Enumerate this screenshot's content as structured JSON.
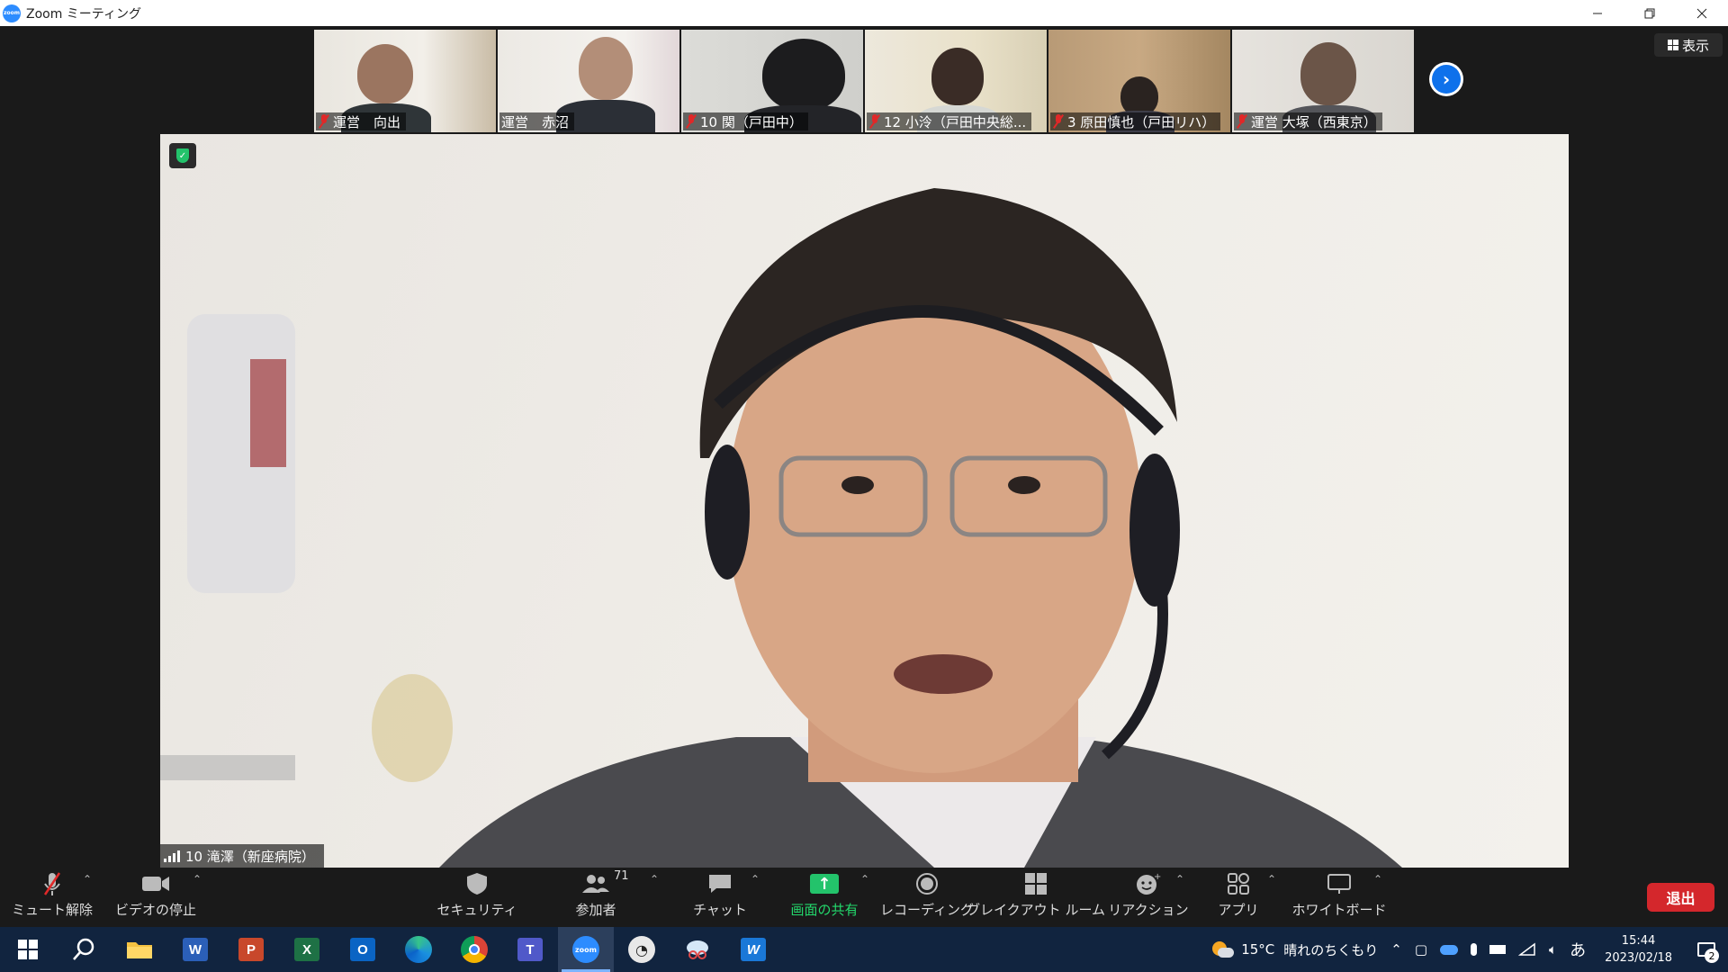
{
  "window": {
    "title": "Zoom ミーティング",
    "app_logo_text": "zoom",
    "controls": [
      "minimize",
      "restore",
      "close"
    ]
  },
  "view_button": {
    "label": "表示"
  },
  "thumbnails": [
    {
      "name": "運営　向出",
      "muted": true
    },
    {
      "name": "運営　赤沼",
      "muted": false
    },
    {
      "name": "10 関（戸田中）",
      "muted": true
    },
    {
      "name": "12 小泠（戸田中央総...",
      "muted": true
    },
    {
      "name": "3 原田慎也（戸田リハ）",
      "muted": true
    },
    {
      "name": "運営 大塚（西東京）",
      "muted": true
    }
  ],
  "next_page_button": {
    "icon": "chevron-right-icon"
  },
  "main_speaker": {
    "name": "10 滝澤（新座病院）"
  },
  "toolbar": {
    "mute": "ミュート解除",
    "video": "ビデオの停止",
    "security": "セキュリティ",
    "participants": "参加者",
    "participants_count": "71",
    "chat": "チャット",
    "share": "画面の共有",
    "record": "レコーディング",
    "breakout": "ブレイクアウト ルーム",
    "reactions": "リアクション",
    "apps": "アプリ",
    "whiteboard": "ホワイトボード",
    "leave": "退出"
  },
  "taskbar": {
    "apps": [
      "windows-start",
      "search",
      "file-explorer",
      "word",
      "powerpoint",
      "excel",
      "outlook",
      "edge",
      "chrome",
      "teams",
      "zoom",
      "clock-app",
      "snipping-tool",
      "writer"
    ],
    "weather_temp": "15°C",
    "weather_desc": "晴れのちくもり",
    "ime": "あ",
    "time": "15:44",
    "date": "2023/02/18",
    "notification_count": "2"
  },
  "colors": {
    "zoom_blue": "#2d8cff",
    "share_green": "#23c36b",
    "leave_red": "#d4272c",
    "muted_red": "#e02828",
    "taskbar_bg": "#11243f"
  }
}
